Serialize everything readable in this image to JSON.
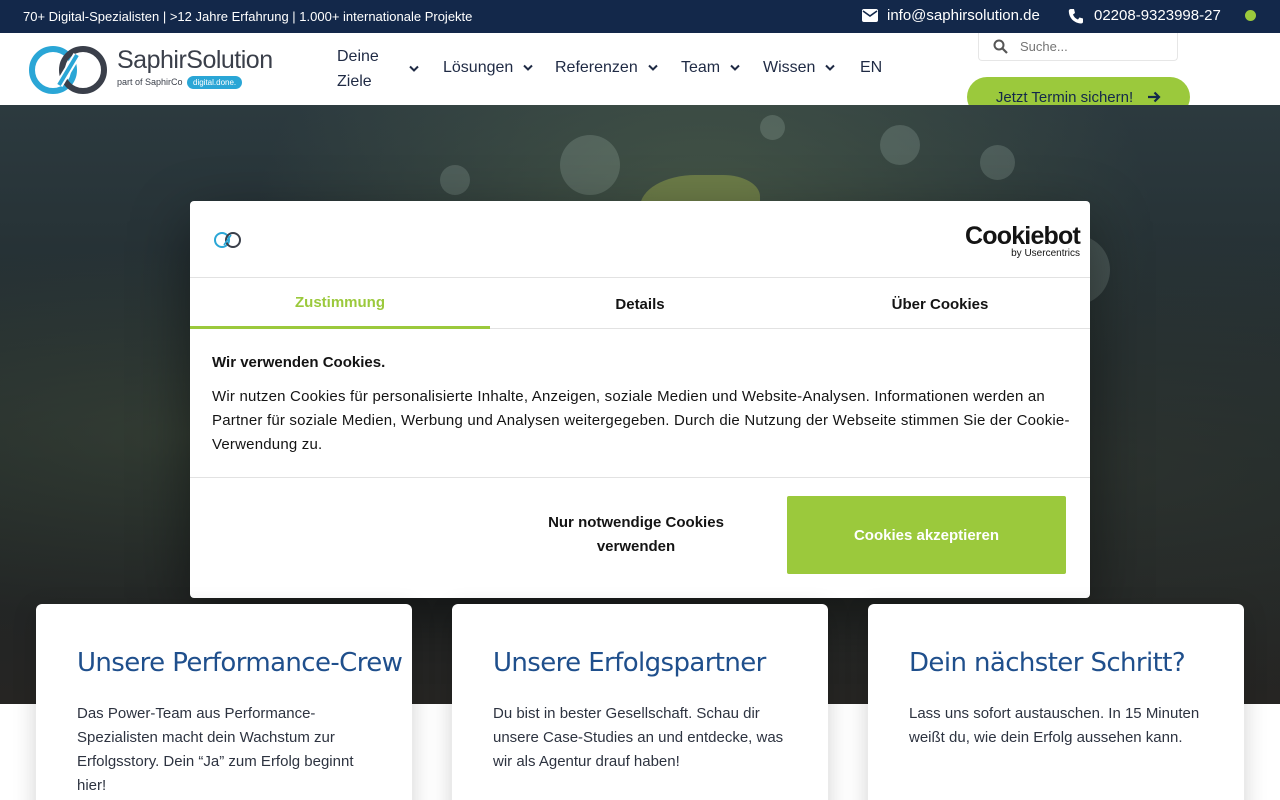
{
  "topbar": {
    "claim": "70+ Digital-Spezialisten | >12 Jahre Erfahrung | 1.000+ internationale Projekte",
    "email": "info@saphirsolution.de",
    "phone": "02208-9323998-27",
    "status_color": "#9bc93c"
  },
  "header": {
    "logo_name": "SaphirSolution",
    "logo_sub": "part of SaphirCo",
    "logo_pill": "digital.done.",
    "nav": [
      {
        "label": "Deine Ziele"
      },
      {
        "label": "Lösungen"
      },
      {
        "label": "Referenzen"
      },
      {
        "label": "Team"
      },
      {
        "label": "Wissen"
      },
      {
        "label": "EN"
      }
    ],
    "search_placeholder": "Suche...",
    "cta_label": "Jetzt Termin sichern!"
  },
  "cookie": {
    "provider_logo": "Cookiebot",
    "provider_sub": "by Usercentrics",
    "tabs": [
      {
        "label": "Zustimmung",
        "active": true
      },
      {
        "label": "Details",
        "active": false
      },
      {
        "label": "Über Cookies",
        "active": false
      }
    ],
    "heading": "Wir verwenden Cookies.",
    "text": "Wir nutzen Cookies für personalisierte Inhalte, Anzeigen, soziale Medien und Website-Analysen. Informationen werden an Partner für soziale Medien, Werbung und Analysen weitergegeben. Durch die Nutzung der Webseite stimmen Sie der Cookie-Verwendung zu.",
    "btn_necessary": "Nur notwendige Cookies verwenden",
    "btn_accept": "Cookies akzeptieren"
  },
  "cards": [
    {
      "title": "Unsere Performance-Crew",
      "text": "Das Power-Team aus Performance-Spezialisten macht dein Wachstum zur Erfolgsstory. Dein “Ja” zum Erfolg beginnt hier!"
    },
    {
      "title": "Unsere Erfolgspartner",
      "text": "Du bist in bester Gesellschaft. Schau dir unsere Case-Studies an und entdecke, was wir als Agentur drauf haben!"
    },
    {
      "title": "Dein nächster Schritt?",
      "text": "Lass uns sofort austauschen. In 15 Minuten weißt du, wie dein Erfolg aussehen kann."
    }
  ],
  "colors": {
    "navy": "#13284a",
    "accent_green": "#9bc93c",
    "logo_blue": "#2aa6d6",
    "card_title": "#1f4f8c"
  }
}
